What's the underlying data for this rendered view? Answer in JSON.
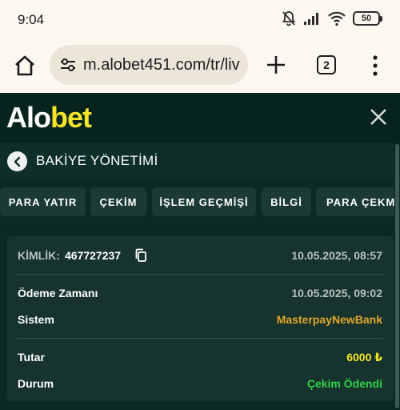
{
  "status_bar": {
    "time": "9:04",
    "battery": "50"
  },
  "browser": {
    "url": "m.alobet451.com/tr/liv",
    "tab_count": "2"
  },
  "site": {
    "logo_left": "Al",
    "logo_o": "o",
    "logo_right": "bet"
  },
  "modal": {
    "title": "BAKİYE YÖNETİMİ"
  },
  "tabs": [
    {
      "label": "PARA YATIR"
    },
    {
      "label": "ÇEKİM"
    },
    {
      "label": "İŞLEM GEÇMİŞİ"
    },
    {
      "label": "BİLGİ"
    },
    {
      "label": "PARA ÇEKME"
    }
  ],
  "transaction": {
    "id_label": "KİMLİK:",
    "id_value": "467727237",
    "created": "10.05.2025, 08:57",
    "rows": [
      {
        "label": "Ödeme Zamanı",
        "value": "10.05.2025, 09:02"
      },
      {
        "label": "Sistem",
        "value": "MasterpayNewBank"
      },
      {
        "label": "Tutar",
        "value": "6000 ₺"
      },
      {
        "label": "Durum",
        "value": "Çekim Ödendi"
      }
    ]
  },
  "colors": {
    "system": "#e0a72c",
    "amount": "#f4e52a",
    "status_paid": "#2fd24c",
    "muted_value": "#b8c2bf"
  },
  "icons": [
    "mute-icon",
    "signal-icon",
    "wifi-icon",
    "battery-icon",
    "home-icon",
    "tune-icon",
    "plus-icon",
    "tabs-icon",
    "more-vert-icon",
    "close-icon",
    "chevron-left-icon",
    "copy-icon"
  ]
}
